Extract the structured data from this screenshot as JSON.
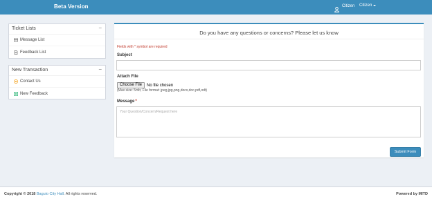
{
  "header": {
    "brand": "Beta Version",
    "user_label": "Citizen",
    "user_menu": "Citizen",
    "bg_color": "#3c8dbc"
  },
  "sidebar": {
    "tickets": {
      "title": "Ticket Lists",
      "collapse": "−",
      "items": [
        {
          "label": "Message List",
          "icon": "envelope-icon"
        },
        {
          "label": "Feedback List",
          "icon": "document-icon"
        }
      ]
    },
    "transaction": {
      "title": "New Transaction",
      "collapse": "−",
      "items": [
        {
          "label": "Contact Us",
          "icon": "contact-circle-icon",
          "color": "#f39c12"
        },
        {
          "label": "New Feedback",
          "icon": "plus-square-icon",
          "color": "#00a65a"
        }
      ]
    }
  },
  "form": {
    "title": "Do you have any questions or concerns? Please let us know",
    "required_note": "Fields with * symbol are required",
    "subject_label": "Subject",
    "subject_value": "",
    "attach_label": "Attach File",
    "choose_button": "Choose File",
    "file_status": "No file chosen",
    "file_help": "(Max size: 5mb; File format: jpeg,jpg,png,docx,doc,pdf,odt)",
    "message_label": "Message",
    "message_required": "*",
    "message_placeholder": "Your Question/Concern/Request here",
    "submit_label": "Submit Form"
  },
  "footer": {
    "copyright_prefix": "Copyright © 2018",
    "link_text": "Baguio City Hall",
    "copyright_suffix": ". All rights reserved.",
    "powered_prefix": "Powered by",
    "powered_brand": "MITD"
  }
}
